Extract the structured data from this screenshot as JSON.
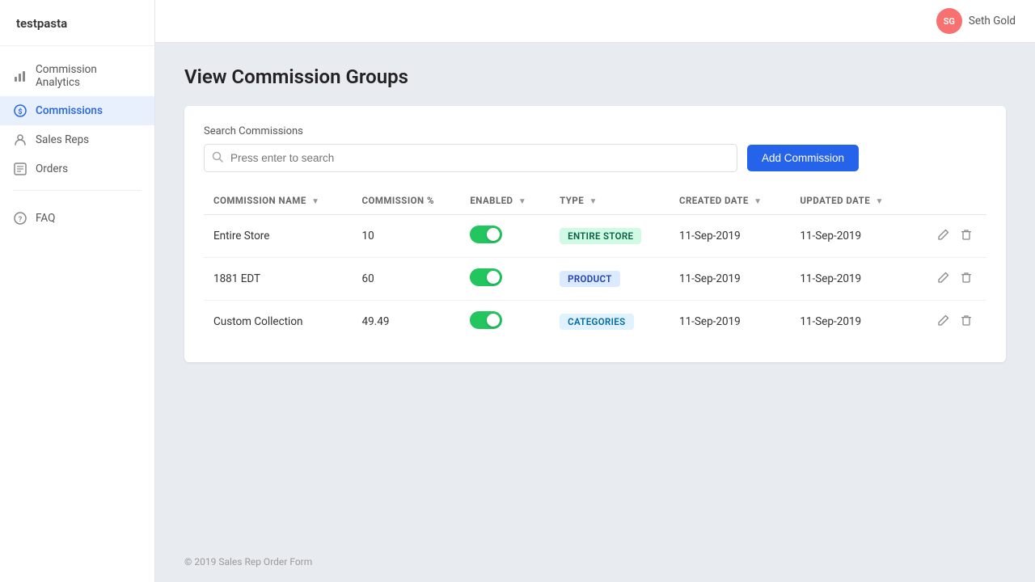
{
  "app": {
    "brand": "testpasta"
  },
  "header": {
    "user_initials": "SG",
    "user_name": "Seth Gold"
  },
  "sidebar": {
    "items": [
      {
        "id": "analytics",
        "label": "Commission Analytics",
        "icon": "chart-icon",
        "active": false
      },
      {
        "id": "commissions",
        "label": "Commissions",
        "icon": "dollar-icon",
        "active": true
      },
      {
        "id": "sales-reps",
        "label": "Sales Reps",
        "icon": "person-icon",
        "active": false
      },
      {
        "id": "orders",
        "label": "Orders",
        "icon": "list-icon",
        "active": false
      }
    ],
    "faq": {
      "label": "FAQ",
      "icon": "help-icon"
    }
  },
  "page": {
    "title": "View Commission Groups",
    "search": {
      "label": "Search Commissions",
      "placeholder": "Press enter to search",
      "value": ""
    },
    "add_button_label": "Add Commission"
  },
  "table": {
    "columns": [
      {
        "id": "name",
        "label": "COMMISSION NAME",
        "sortable": true
      },
      {
        "id": "percent",
        "label": "COMMISSION %",
        "sortable": false
      },
      {
        "id": "enabled",
        "label": "ENABLED",
        "sortable": true
      },
      {
        "id": "type",
        "label": "TYPE",
        "sortable": true
      },
      {
        "id": "created",
        "label": "CREATED DATE",
        "sortable": true
      },
      {
        "id": "updated",
        "label": "UPDATED DATE",
        "sortable": true
      }
    ],
    "rows": [
      {
        "name": "Entire Store",
        "percent": "10",
        "enabled": true,
        "type": "ENTIRE STORE",
        "type_badge": "store",
        "created": "11-Sep-2019",
        "updated": "11-Sep-2019"
      },
      {
        "name": "1881 EDT",
        "percent": "60",
        "enabled": true,
        "type": "PRODUCT",
        "type_badge": "product",
        "created": "11-Sep-2019",
        "updated": "11-Sep-2019"
      },
      {
        "name": "Custom Collection",
        "percent": "49.49",
        "enabled": true,
        "type": "CATEGORIES",
        "type_badge": "categories",
        "created": "11-Sep-2019",
        "updated": "11-Sep-2019"
      }
    ]
  },
  "footer": {
    "text": "© 2019 Sales Rep Order Form"
  }
}
